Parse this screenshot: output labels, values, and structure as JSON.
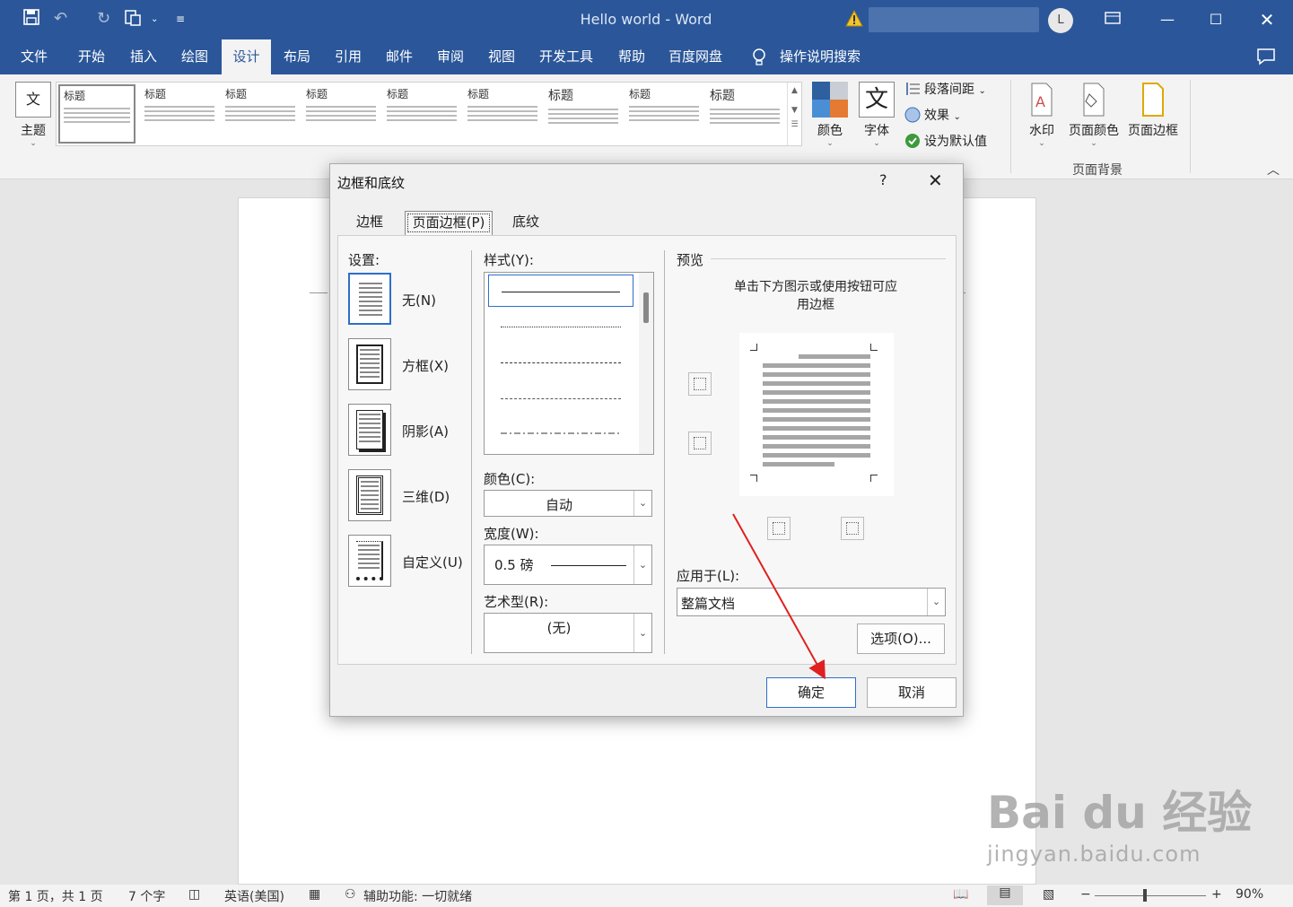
{
  "window": {
    "title": "Hello world  -  Word",
    "avatar_initial": "L"
  },
  "menu": {
    "tabs": [
      "文件",
      "开始",
      "插入",
      "绘图",
      "设计",
      "布局",
      "引用",
      "邮件",
      "审阅",
      "视图",
      "开发工具",
      "帮助",
      "百度网盘"
    ],
    "active_tab": "设计",
    "tell_me": "操作说明搜索"
  },
  "ribbon": {
    "theme_label": "主题",
    "gallery_items": [
      "标题",
      "标题",
      "标题",
      "标题",
      "标题",
      "标题",
      "标题",
      "标题",
      "标题"
    ],
    "colors_label": "颜色",
    "fonts_label": "字体",
    "paragraph_spacing": "段落间距",
    "effects": "效果",
    "set_default": "设为默认值",
    "watermark": "水印",
    "page_color": "页面颜色",
    "page_borders": "页面边框",
    "group_page_background": "页面背景",
    "theme_icon_text": "文",
    "fonts_icon_text": "文"
  },
  "dialog": {
    "title": "边框和底纹",
    "help": "?",
    "tabs": [
      "边框(B)",
      "页面边框(P)",
      "底纹(S)"
    ],
    "active_tab": "页面边框(P)",
    "setting_label": "设置:",
    "settings": [
      "无(N)",
      "方框(X)",
      "阴影(A)",
      "三维(D)",
      "自定义(U)"
    ],
    "style_label": "样式(Y):",
    "color_label": "颜色(C):",
    "color_value": "自动",
    "width_label": "宽度(W):",
    "width_value": "0.5 磅",
    "art_label": "艺术型(R):",
    "art_value": "(无)",
    "preview_label": "预览",
    "preview_hint_1": "单击下方图示或使用按钮可应",
    "preview_hint_2": "用边框",
    "apply_label": "应用于(L):",
    "apply_value": "整篇文档",
    "options_button": "选项(O)...",
    "ok_button": "确定",
    "cancel_button": "取消"
  },
  "statusbar": {
    "page": "第 1 页，共 1 页",
    "words": "7 个字",
    "language": "英语(美国)",
    "accessibility": "辅助功能: 一切就绪",
    "zoom": "90%"
  },
  "watermark": {
    "brand": "Bai du 经验",
    "url": "jingyan.baidu.com"
  },
  "colors": {
    "title_bar": "#2b579a",
    "accent_blue": "#2f6ecb",
    "arrow_red": "#e02020"
  }
}
